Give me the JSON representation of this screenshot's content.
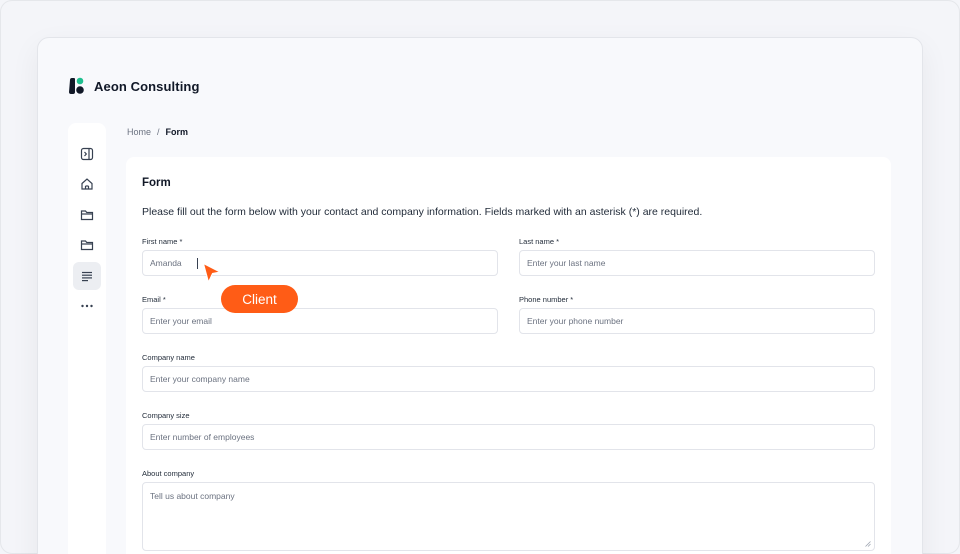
{
  "app": {
    "name": "Aeon Consulting"
  },
  "sidebar": {
    "items": [
      {
        "icon": "sidebar-toggle-icon"
      },
      {
        "icon": "home-icon"
      },
      {
        "icon": "folder-icon"
      },
      {
        "icon": "folder-icon"
      },
      {
        "icon": "form-icon",
        "active": true
      },
      {
        "icon": "more-icon"
      }
    ]
  },
  "breadcrumb": {
    "home": "Home",
    "separator": "/",
    "current": "Form"
  },
  "form": {
    "title": "Form",
    "description": "Please fill out the form below with your contact and company information. Fields marked with an asterisk (*) are required.",
    "fields": {
      "first_name": {
        "label": "First name *",
        "value": "Amanda",
        "placeholder": ""
      },
      "last_name": {
        "label": "Last name *",
        "value": "",
        "placeholder": "Enter your last name"
      },
      "email": {
        "label": "Email *",
        "value": "",
        "placeholder": "Enter your email"
      },
      "phone": {
        "label": "Phone number *",
        "value": "",
        "placeholder": "Enter your phone number"
      },
      "company_name": {
        "label": "Company name",
        "value": "",
        "placeholder": "Enter your company name"
      },
      "company_size": {
        "label": "Company size",
        "value": "",
        "placeholder": "Enter number of employees"
      },
      "about_company": {
        "label": "About company",
        "value": "",
        "placeholder": "Tell us about company"
      }
    }
  },
  "cursor": {
    "label": "Client",
    "color": "#ff5c16"
  },
  "colors": {
    "accent": "#ff5c16",
    "brand_green": "#1fbf8f",
    "brand_dark": "#111827"
  }
}
